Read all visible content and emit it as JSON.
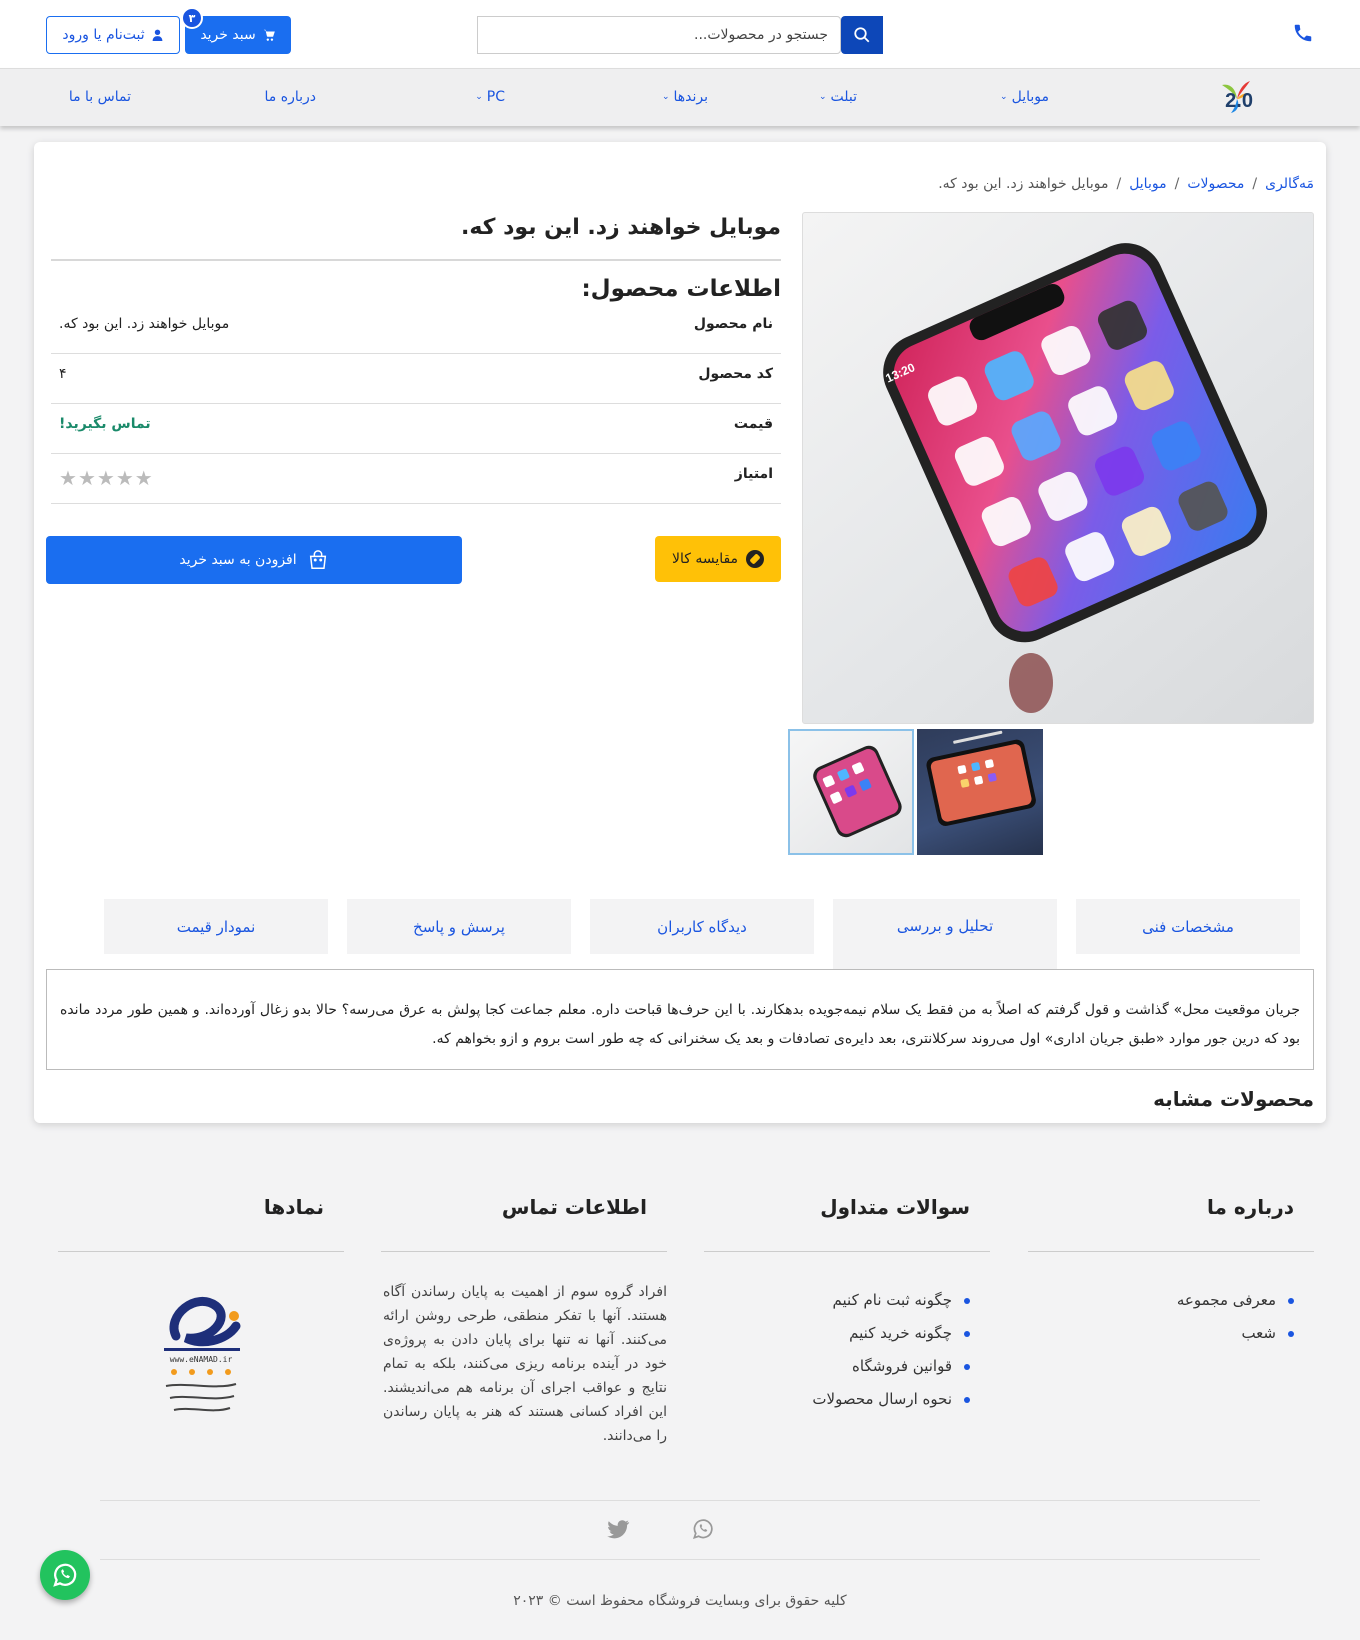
{
  "header": {
    "search_placeholder": "جستجو در محصولات...",
    "cart_label": "سبد خرید",
    "cart_count": "۳",
    "login_label": "ثبت‌نام یا ورود"
  },
  "nav": {
    "logo_text": "yii 2.0",
    "items": [
      {
        "label": "موبایل",
        "has_dropdown": true
      },
      {
        "label": "تبلت",
        "has_dropdown": true
      },
      {
        "label": "برندها",
        "has_dropdown": true
      },
      {
        "label": "PC",
        "has_dropdown": true
      },
      {
        "label": "درباره ما",
        "has_dropdown": false
      },
      {
        "label": "تماس با ما",
        "has_dropdown": false
      }
    ]
  },
  "breadcrumb": {
    "items": [
      "مَه‌گالری",
      "محصولات",
      "موبایل"
    ],
    "separator": "/",
    "active": "موبایل خواهند زد. این بود که."
  },
  "product": {
    "title": "موبایل خواهند زد. این بود که.",
    "info_heading": "اطلاعات محصول:",
    "rows": [
      {
        "label": "نام محصول",
        "value": "موبایل خواهند زد. این بود که."
      },
      {
        "label": "کد محصول",
        "value": "۴"
      },
      {
        "label": "قیمت",
        "value": "تماس بگیرید!"
      },
      {
        "label": "امتیاز",
        "value": ""
      }
    ],
    "rating": 0,
    "rating_max": 5,
    "compare_label": "مقایسه کالا",
    "add_to_cart_label": "افزودن به سبد خرید",
    "phone_time": "13:20"
  },
  "tabs": {
    "items": [
      "مشخصات فنی",
      "تحلیل و بررسی",
      "دیدگاه کاربران",
      "پرسش و پاسخ",
      "نمودار قیمت"
    ],
    "active_index": 1,
    "content": "جریان موقعیت محل» گذاشت و قول گرفتم که اصلاً به من فقط یک سلام نیمه‌جویده بدهکارند. با این حرف‌ها قباحت داره. معلم جماعت کجا پولش به عرق می‌رسه؟ حالا بدو زغال آورده‌اند. و همین طور مردد مانده بود که درین جور موارد «طبق جریان اداری» اول می‌روند سرکلانتری، بعد دایره‌ی تصادفات و بعد یک سخنرانی که چه طور است بروم و ازو بخواهم که."
  },
  "similar_heading": "محصولات مشابه",
  "footer": {
    "about": {
      "title": "درباره ما",
      "links": [
        "معرفی مجموعه",
        "شعب"
      ]
    },
    "faq": {
      "title": "سوالات متداول",
      "links": [
        "چگونه ثبت نام کنیم",
        "چگونه خرید کنیم",
        "قوانین فروشگاه",
        "نحوه ارسال محصولات"
      ]
    },
    "contact": {
      "title": "اطلاعات تماس",
      "text": "افراد گروه سوم از اهمیت به پایان رساندن آگاه هستند. آنها با تفکر منطقی، طرحی روشن ارائه می‌کنند. آنها نه تنها برای پایان دادن به پروژه‌ی خود در آینده برنامه ریزی می‌کنند، بلکه به تمام نتایج و عواقب اجرای آن برنامه هم می‌اندیشند. این افراد کسانی هستند که هنر به پایان رساندن را می‌دانند."
    },
    "badges": {
      "title": "نمادها",
      "enamad_url": "www.eNAMAD.ir"
    },
    "copyright": "کلیه حقوق برای وبسایت فروشگاه محفوظ است © ۲۰۲۳"
  },
  "colors": {
    "primary": "#1a6ef0",
    "link": "#1a55e0",
    "warning": "#ffc107",
    "success": "#1a8a6a"
  }
}
